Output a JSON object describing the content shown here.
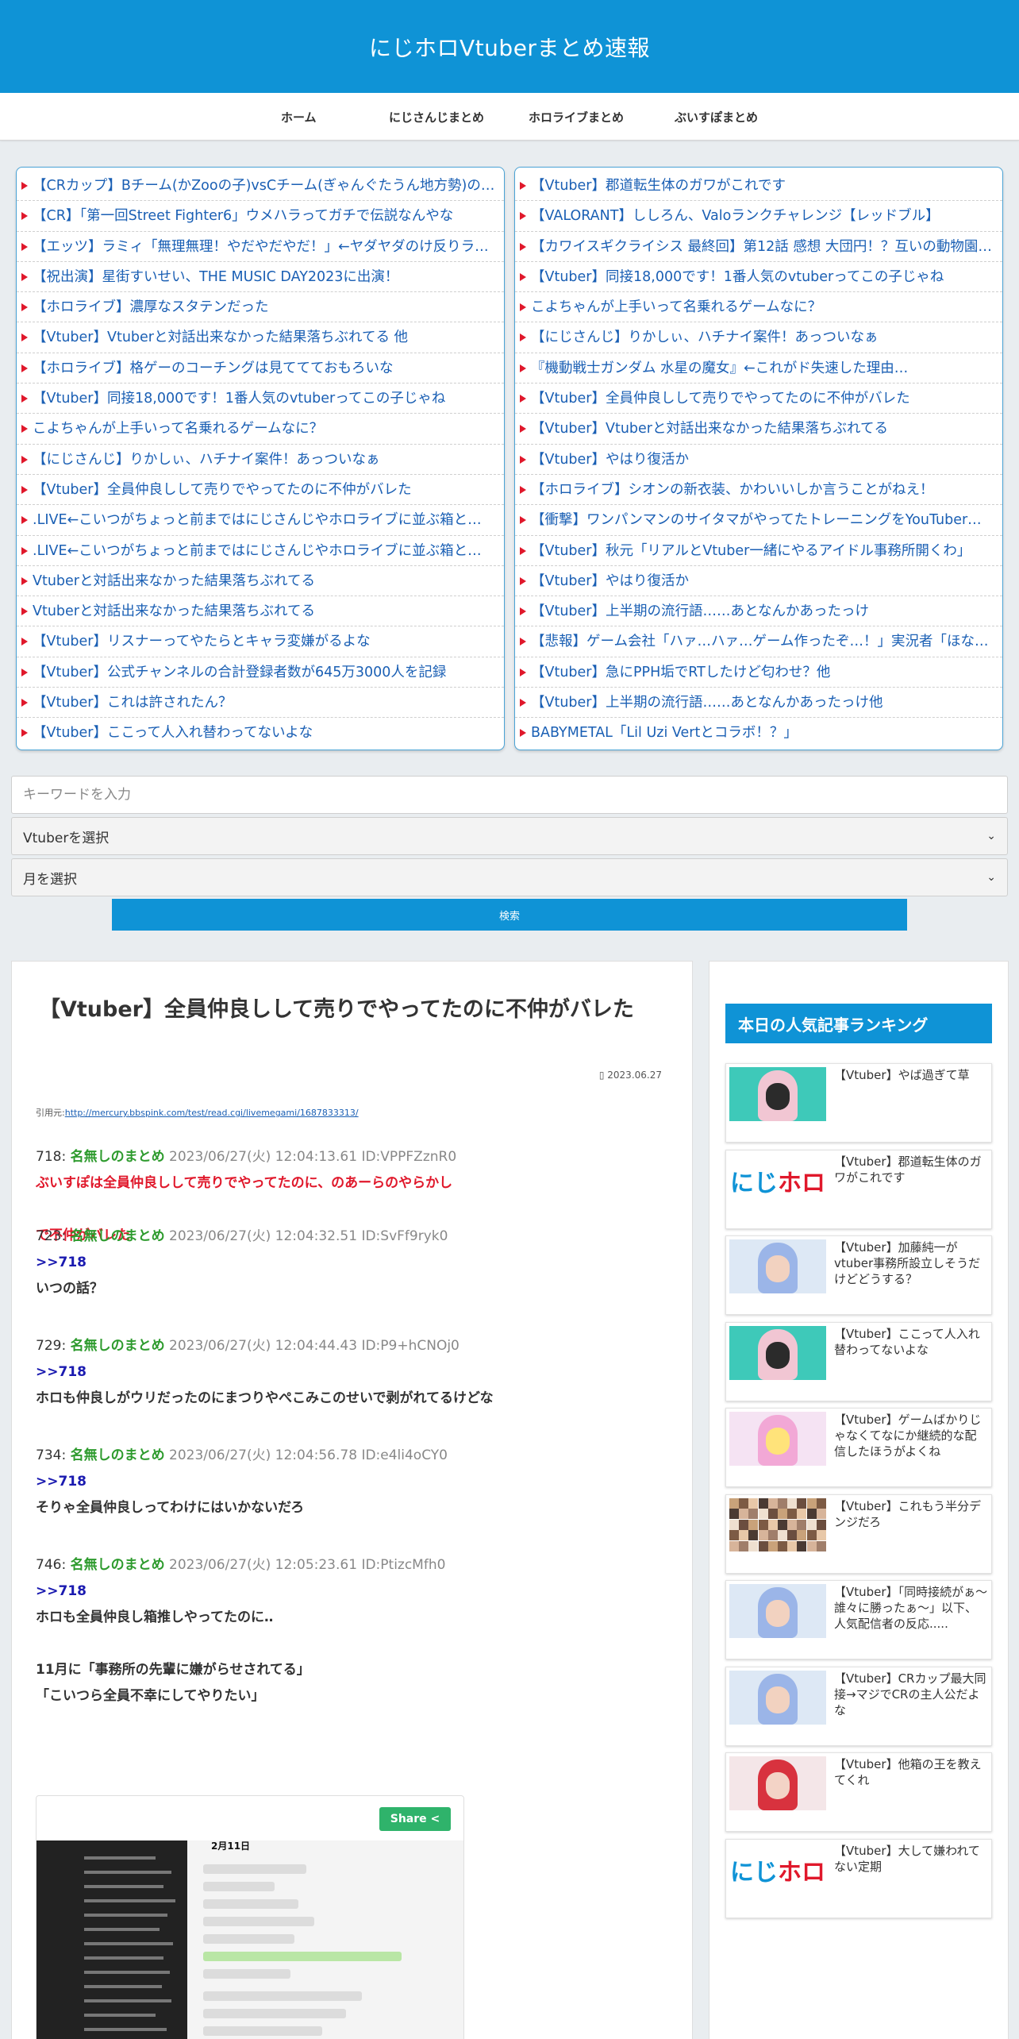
{
  "header": {
    "site_title": "にじホロVtuberまとめ速報"
  },
  "nav": {
    "items": [
      "ホーム",
      "にじさんじまとめ",
      "ホロライブまとめ",
      "ぶいすぽまとめ"
    ]
  },
  "antenna_left": [
    "【CRカップ】Bチーム(かZooの子)vsCチーム(ぎゃんぐたうん地方勢)の…",
    "【CR】「第一回Street Fighter6」ウメハラってガチで伝説なんやな",
    "【エッツ】ラミィ「無理無理！やだやだやだ！」←ヤダヤダのけ反りラ…",
    "【祝出演】星街すいせい、THE MUSIC DAY2023に出演！",
    "【ホロライブ】濃厚なスタテンだった",
    "【Vtuber】Vtuberと対話出来なかった結果落ちぶれてる 他",
    "【ホロライブ】格ゲーのコーチングは見ててておもろいな",
    "【Vtuber】同接18,000です！1番人気のvtuberってこの子じゃね",
    "こよちゃんが上手いって名乗れるゲームなに？",
    "【にじさんじ】りかしぃ、ハチナイ案件！あっついなぁ",
    "【Vtuber】全員仲良しして売りでやってたのに不仲がバレた",
    ".LIVE←こいつがちょっと前まではにじさんじやホロライブに並ぶ箱と…",
    ".LIVE←こいつがちょっと前まではにじさんじやホロライブに並ぶ箱と…",
    "Vtuberと対話出来なかった結果落ちぶれてる",
    "Vtuberと対話出来なかった結果落ちぶれてる",
    "【Vtuber】リスナーってやたらとキャラ変嫌がるよな",
    "【Vtuber】公式チャンネルの合計登録者数が645万3000人を記録",
    "【Vtuber】これは許されたん？",
    "【Vtuber】ここって人入れ替わってないよな"
  ],
  "antenna_right": [
    "【Vtuber】郡道転生体のガワがこれです",
    "【VALORANT】ししろん、Valoランクチャレンジ【レッドブル】",
    "【カワイスギクライシス 最終回】第12話 感想 大団円！？互いの動物園…",
    "【Vtuber】同接18,000です！1番人気のvtuberってこの子じゃね",
    "こよちゃんが上手いって名乗れるゲームなに？",
    "【にじさんじ】りかしぃ、ハチナイ案件！あっついなぁ",
    "『機動戦士ガンダム 水星の魔女』←これがド失速した理由…",
    "【Vtuber】全員仲良しして売りでやってたのに不仲がバレた",
    "【Vtuber】Vtuberと対話出来なかった結果落ちぶれてる",
    "【Vtuber】やはり復活か",
    "【ホロライブ】シオンの新衣装、かわいいしか言うことがねえ！",
    "【衝撃】ワンパンマンのサイタマがやってたトレーニングをYouTuber…",
    "【Vtuber】秋元「リアルとVtuber一緒にやるアイドル事務所開くわ」",
    "【Vtuber】やはり復活か",
    "【Vtuber】上半期の流行語……あとなんかあったっけ",
    "【悲報】ゲーム会社「ハァ…ハァ…ゲーム作ったぞ…！」実況者「ほな…",
    "【Vtuber】急にPPH垢でRTしたけど匂わせ？他",
    "【Vtuber】上半期の流行語……あとなんかあったっけ他",
    "BABYMETAL「Lil Uzi Vertとコラボ！？」"
  ],
  "search": {
    "placeholder": "キーワードを入力",
    "vtuber_select": "Vtuberを選択",
    "month_select": "月を選択",
    "button_label": "検索"
  },
  "article": {
    "title": "【Vtuber】全員仲良しして売りでやってたのに不仲がバレた",
    "date": "2023.06.27",
    "source_prefix": "引用元:",
    "source_url": "http://mercury.bbspink.com/test/read.cgi/livemegami/1687833313/",
    "posts": [
      {
        "num": "718:",
        "name": "名無しのまとめ",
        "meta": "2023/06/27(火) 12:04:13.61 ID:VPPFZznR0",
        "anchor": "",
        "body": "ぶいすぽは全員仲良しして売りでやってたのに、のあーらのやらかし\n\nで不仲がバレた",
        "red": true
      },
      {
        "num": "723:",
        "name": "名無しのまとめ",
        "meta": "2023/06/27(火) 12:04:32.51 ID:SvFf9ryk0",
        "anchor": ">>718",
        "body": "いつの話？",
        "red": false
      },
      {
        "num": "729:",
        "name": "名無しのまとめ",
        "meta": "2023/06/27(火) 12:04:44.43 ID:P9+hCNOj0",
        "anchor": ">>718",
        "body": "ホロも仲良しがウリだったのにまつりやぺこみこのせいで剥がれてるけどな",
        "red": false
      },
      {
        "num": "734:",
        "name": "名無しのまとめ",
        "meta": "2023/06/27(火) 12:04:56.78 ID:e4li4oCY0",
        "anchor": ">>718",
        "body": "そりゃ全員仲良しってわけにはいかないだろ",
        "red": false
      },
      {
        "num": "746:",
        "name": "名無しのまとめ",
        "meta": "2023/06/27(火) 12:05:23.61 ID:PtizcMfh0",
        "anchor": ">>718",
        "body": "ホロも全員仲良し箱推しやってたのに‥\n\n11月に「事務所の先輩に嫌がらせされてる」\n「こいつら全員不幸にしてやりたい」",
        "red": false
      }
    ],
    "embed": {
      "share_label": "Share",
      "shot_date": "2月11日"
    }
  },
  "sidebar": {
    "ranking_title": "本日の人気記事ランキング",
    "items": [
      {
        "text": "【Vtuber】やば過ぎて草",
        "thumb": "char-witch"
      },
      {
        "text": "【Vtuber】郡道転生体のガワがこれです",
        "thumb": "logo"
      },
      {
        "text": "【Vtuber】加藤純一がvtuber事務所設立しそうだけどどうする？",
        "thumb": "char-blue"
      },
      {
        "text": "【Vtuber】ここって人入れ替わってないよな",
        "thumb": "char-witch"
      },
      {
        "text": "【Vtuber】ゲームばかりじゃなくてなにか継続的な配信したほうがよくね",
        "thumb": "char-pink"
      },
      {
        "text": "【Vtuber】これもう半分デンジだろ",
        "thumb": "collage"
      },
      {
        "text": "【Vtuber】「同時接続がぁ〜誰々に勝ったぁ〜」以下、人気配信者の反応.....",
        "thumb": "char-blue"
      },
      {
        "text": "【Vtuber】CRカップ最大同接→マジでCRの主人公だよな",
        "thumb": "char-blue"
      },
      {
        "text": "【Vtuber】他箱の王を教えてくれ",
        "thumb": "char-red"
      },
      {
        "text": "【Vtuber】大して嫌われてない定期",
        "thumb": "logo"
      }
    ],
    "logo_text_1": "にじ",
    "logo_text_2": "ホロ"
  },
  "colors": {
    "brand_blue": "#0f93d6",
    "link_blue": "#1a5fb4",
    "bullet_red": "#e0182b",
    "name_green": "#2e9b2e",
    "share_green": "#2fb36b"
  }
}
